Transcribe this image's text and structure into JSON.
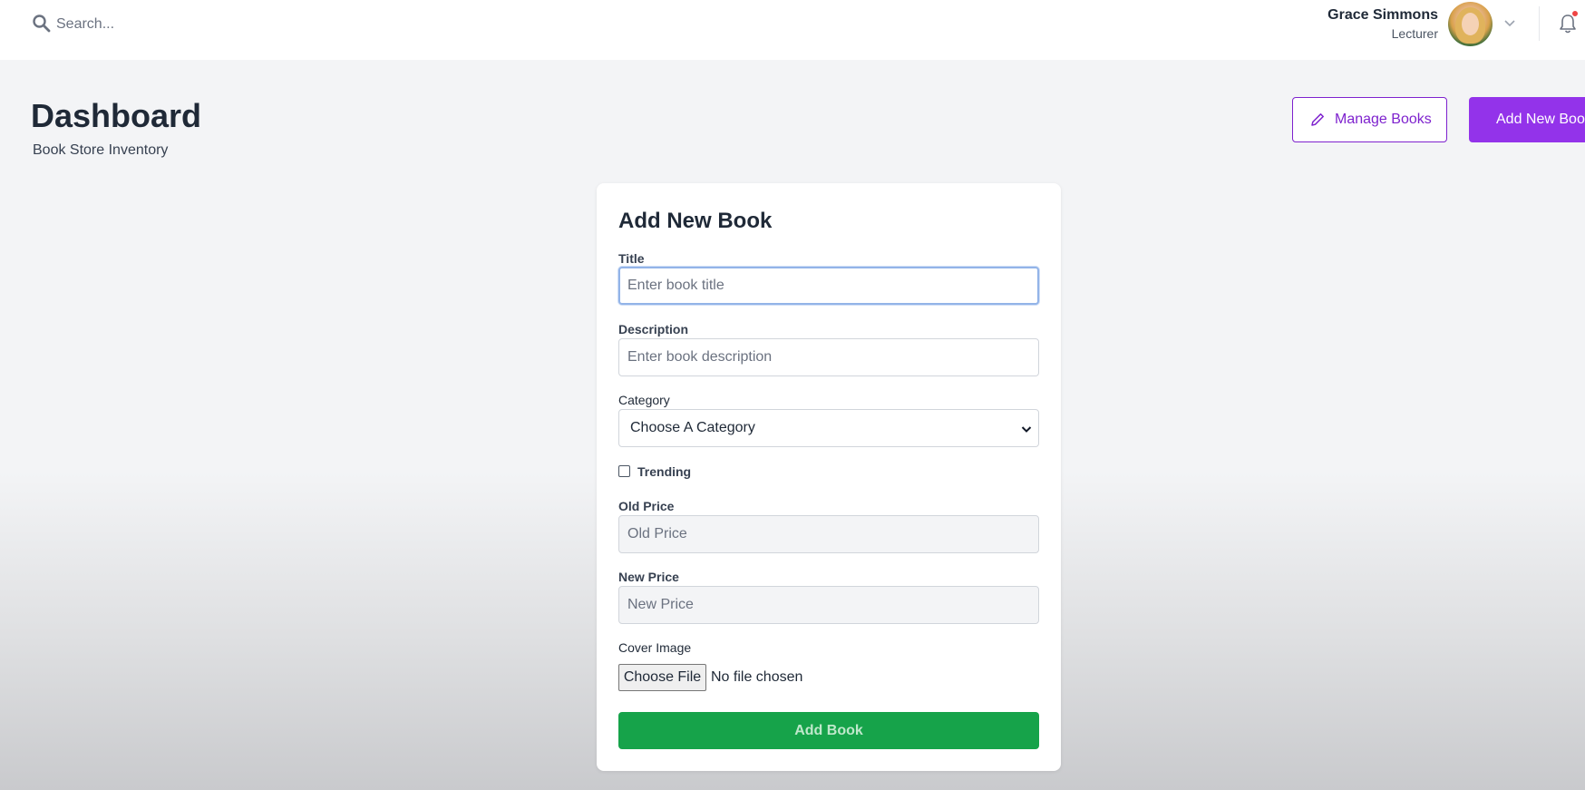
{
  "topbar": {
    "search_placeholder": "Search...",
    "user_name": "Grace Simmons",
    "user_role": "Lecturer",
    "notification_dot_color": "#ef4444"
  },
  "header": {
    "title": "Dashboard",
    "subtitle": "Book Store Inventory",
    "manage_books_label": "Manage Books",
    "add_new_book_label": "Add New Book",
    "accent_color": "#9333ea"
  },
  "form": {
    "title": "Add New Book",
    "fields": {
      "title": {
        "label": "Title",
        "placeholder": "Enter book title"
      },
      "description": {
        "label": "Description",
        "placeholder": "Enter book description"
      },
      "category": {
        "label": "Category",
        "selected": "Choose A Category"
      },
      "trending": {
        "label": "Trending",
        "checked": false
      },
      "old_price": {
        "label": "Old Price",
        "placeholder": "Old Price"
      },
      "new_price": {
        "label": "New Price",
        "placeholder": "New Price"
      },
      "cover_image": {
        "label": "Cover Image",
        "button_label": "Choose File",
        "status": "No file chosen"
      }
    },
    "submit_label": "Add Book",
    "submit_color": "#16a34a"
  },
  "icons": [
    "search-icon",
    "chevron-down-icon",
    "bell-icon",
    "pencil-icon",
    "plus-icon"
  ]
}
